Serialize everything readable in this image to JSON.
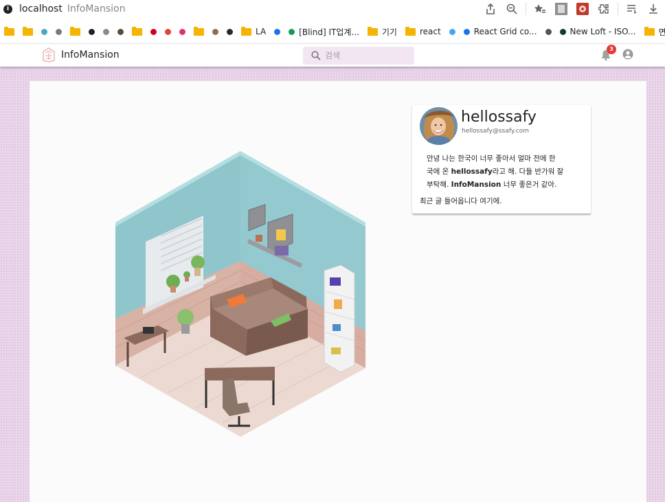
{
  "browser": {
    "url_host": "localhost",
    "tab_title": "InfoMansion",
    "bookmarks": [
      {
        "type": "folder",
        "label": ""
      },
      {
        "type": "folder",
        "label": ""
      },
      {
        "type": "dot",
        "color": "#4aa7c7",
        "label": ""
      },
      {
        "type": "dot",
        "color": "#7a7a7a",
        "label": ""
      },
      {
        "type": "folder",
        "label": ""
      },
      {
        "type": "dot",
        "color": "#222222",
        "label": ""
      },
      {
        "type": "dot",
        "color": "#8a8a8a",
        "label": ""
      },
      {
        "type": "dot",
        "color": "#5a4a3a",
        "label": ""
      },
      {
        "type": "folder",
        "label": ""
      },
      {
        "type": "dot",
        "color": "#d0021b",
        "label": ""
      },
      {
        "type": "dot",
        "color": "#e0453a",
        "label": ""
      },
      {
        "type": "dot",
        "color": "#e0307a",
        "label": ""
      },
      {
        "type": "folder",
        "label": ""
      },
      {
        "type": "dot",
        "color": "#8d6e55",
        "label": ""
      },
      {
        "type": "dot",
        "color": "#2a2a2a",
        "label": ""
      },
      {
        "type": "folder",
        "label": "LA"
      },
      {
        "type": "dot",
        "color": "#1a73e8",
        "label": ""
      },
      {
        "type": "dot",
        "color": "#0f9d58",
        "label": "[Blind] IT업계..."
      },
      {
        "type": "folder",
        "label": "기기"
      },
      {
        "type": "folder",
        "label": "react"
      },
      {
        "type": "dot",
        "color": "#42a5f5",
        "label": ""
      },
      {
        "type": "dot",
        "color": "#1a73e8",
        "label": "React Grid co..."
      },
      {
        "type": "dot",
        "color": "#555555",
        "label": ""
      },
      {
        "type": "dot",
        "color": "#0d3d2b",
        "label": "New Loft - ISO..."
      },
      {
        "type": "folder",
        "label": "면접"
      }
    ]
  },
  "header": {
    "brand": "InfoMansion",
    "search_placeholder": "검색",
    "notification_count": "3"
  },
  "profile": {
    "username": "hellossafy",
    "email": "hellossafy@ssafy.com",
    "bio_lines": [
      [
        "안녕 나는 한국이 너무 좋아서 얼마 전에 한"
      ],
      [
        "국에 온 ",
        "hellossafy",
        "라고 해. 다들 반가워 잘"
      ],
      [
        "부탁해. ",
        "InfoMansion",
        " 너무 좋은거 같아."
      ]
    ],
    "recent_posts_text": "최근 글 들어옵니다 여기에."
  },
  "colors": {
    "accent": "#ead5ea",
    "search_bg": "#f3e6f3",
    "badge": "#e53935",
    "room_wall": "#93c9cf"
  },
  "icons": [
    "info-icon",
    "share-icon",
    "zoom-out-icon",
    "bookmark-star-icon",
    "extension-icon",
    "reading-list-icon",
    "download-icon",
    "search-icon",
    "bell-icon",
    "account-icon"
  ]
}
